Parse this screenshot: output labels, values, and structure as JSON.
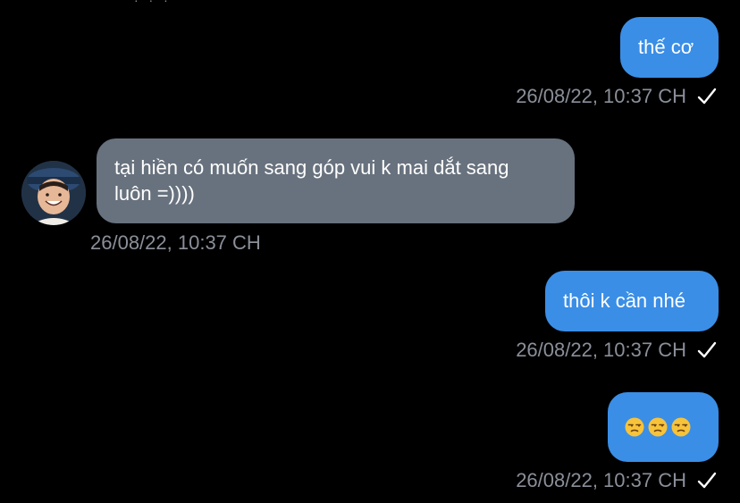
{
  "conversation": {
    "messages": [
      {
        "direction": "outgoing",
        "text": "thế cơ",
        "timestamp": "26/08/22, 10:37 CH",
        "status_icon": "checkmark-icon"
      },
      {
        "direction": "incoming",
        "text_line1": "tại hiền có muốn sang góp vui k mai dắt sang",
        "text_line2": "luôn =))))",
        "timestamp": "26/08/22, 10:37 CH",
        "avatar": "user-avatar"
      },
      {
        "direction": "outgoing",
        "text": "thôi k cần nhé",
        "timestamp": "26/08/22, 10:37 CH",
        "status_icon": "checkmark-icon"
      },
      {
        "direction": "outgoing",
        "emojis": [
          "unamused-face-icon",
          "unamused-face-icon",
          "unamused-face-icon"
        ],
        "timestamp": "26/08/22, 10:37 CH",
        "status_icon": "checkmark-icon"
      }
    ]
  },
  "colors": {
    "background": "#000000",
    "outgoing_bubble": "#3a8ee6",
    "incoming_bubble": "#68727e",
    "timestamp_text": "#8a8f99"
  }
}
